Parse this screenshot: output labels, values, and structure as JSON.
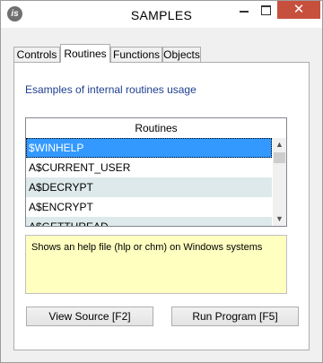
{
  "window": {
    "title": "SAMPLES",
    "icon_text": "is",
    "close_glyph": "✕"
  },
  "tabs": [
    {
      "label": "Controls",
      "active": false
    },
    {
      "label": "Routines",
      "active": true
    },
    {
      "label": "Functions",
      "active": false
    },
    {
      "label": "Objects",
      "active": false
    }
  ],
  "panel": {
    "description": "Esamples of internal routines usage",
    "list": {
      "header": "Routines",
      "items": [
        "$WINHELP",
        "A$CURRENT_USER",
        "A$DECRYPT",
        "A$ENCRYPT",
        "A$GETTHREAD"
      ],
      "selected_index": 0
    },
    "info_text": "Shows an help file (hlp or chm) on Windows systems",
    "buttons": {
      "view_source": "View Source [F2]",
      "run_program": "Run Program [F5]"
    }
  },
  "colors": {
    "selection": "#3399ff",
    "row_alt": "#dde9ea",
    "info_bg": "#ffffc0",
    "description_text": "#1e3f8f",
    "close_button": "#c7503d"
  }
}
